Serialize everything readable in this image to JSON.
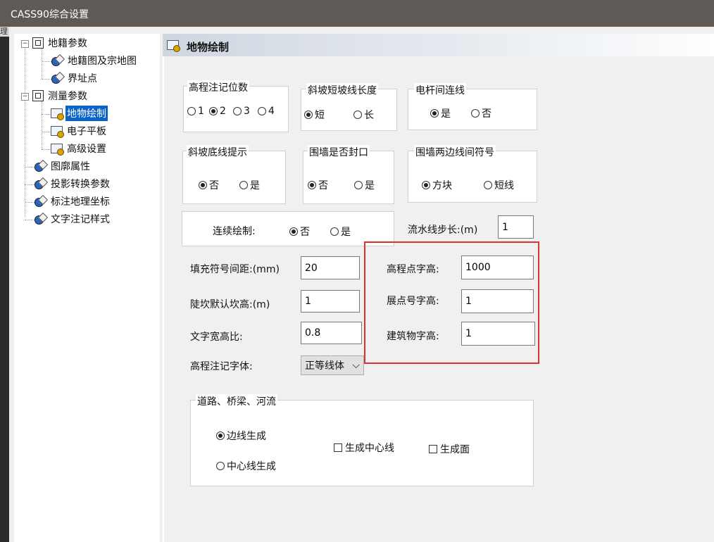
{
  "window": {
    "title": "CASS90综合设置",
    "edge_glyph": "理"
  },
  "tree": {
    "nodes": [
      {
        "label": "地籍参数"
      },
      {
        "label": "地籍图及宗地图"
      },
      {
        "label": "界址点"
      },
      {
        "label": "测量参数"
      },
      {
        "label": "地物绘制",
        "selected": true
      },
      {
        "label": "电子平板"
      },
      {
        "label": "高级设置"
      },
      {
        "label": "图廓属性"
      },
      {
        "label": "投影转换参数"
      },
      {
        "label": "标注地理坐标"
      },
      {
        "label": "文字注记样式"
      }
    ],
    "expander": "−"
  },
  "panel": {
    "title": "地物绘制",
    "elev_digits": {
      "label": "高程注记位数",
      "options": [
        "1",
        "2",
        "3",
        "4"
      ],
      "selected": "2"
    },
    "slope_len": {
      "label": "斜坡短坡线长度",
      "options": [
        "短",
        "长"
      ],
      "selected": "短"
    },
    "pole_link": {
      "label": "电杆间连线",
      "options": [
        "是",
        "否"
      ],
      "selected": "是"
    },
    "slope_base": {
      "label": "斜坡底线提示",
      "options": [
        "否",
        "是"
      ],
      "selected": "否"
    },
    "wall_closed": {
      "label": "围墙是否封口",
      "options": [
        "否",
        "是"
      ],
      "selected": "否"
    },
    "wall_symbol": {
      "label": "围墙两边线间符号",
      "options": [
        "方块",
        "短线"
      ],
      "selected": "方块"
    },
    "continuous": {
      "label": "连续绘制:",
      "options": [
        "否",
        "是"
      ],
      "selected": "否"
    },
    "flow_step": {
      "label": "流水线步长:(m)",
      "value": "1"
    },
    "fill_spacing": {
      "label": "填充符号间距:(mm)",
      "value": "20"
    },
    "pit_height": {
      "label": "陡坎默认坎高:(m)",
      "value": "1"
    },
    "text_ratio": {
      "label": "文字宽高比:",
      "value": "0.8"
    },
    "elev_font": {
      "label": "高程注记字体:",
      "value": "正等线体",
      "arrow": "⌵"
    },
    "elev_pt_height": {
      "label": "高程点字高:",
      "value": "1000"
    },
    "spread_pt_height": {
      "label": "展点号字高:",
      "value": "1"
    },
    "building_height": {
      "label": "建筑物字高:",
      "value": "1"
    },
    "road": {
      "label": "道路、桥梁、河流",
      "options": [
        "边线生成",
        "中心线生成"
      ],
      "selected": "边线生成",
      "centerline": {
        "label": "生成中心线",
        "checked": false
      },
      "face": {
        "label": "生成面",
        "checked": false
      }
    }
  },
  "colors": {
    "highlight": "#e03030",
    "selection": "#0a64c8",
    "titlebar": "#5f5a55"
  }
}
